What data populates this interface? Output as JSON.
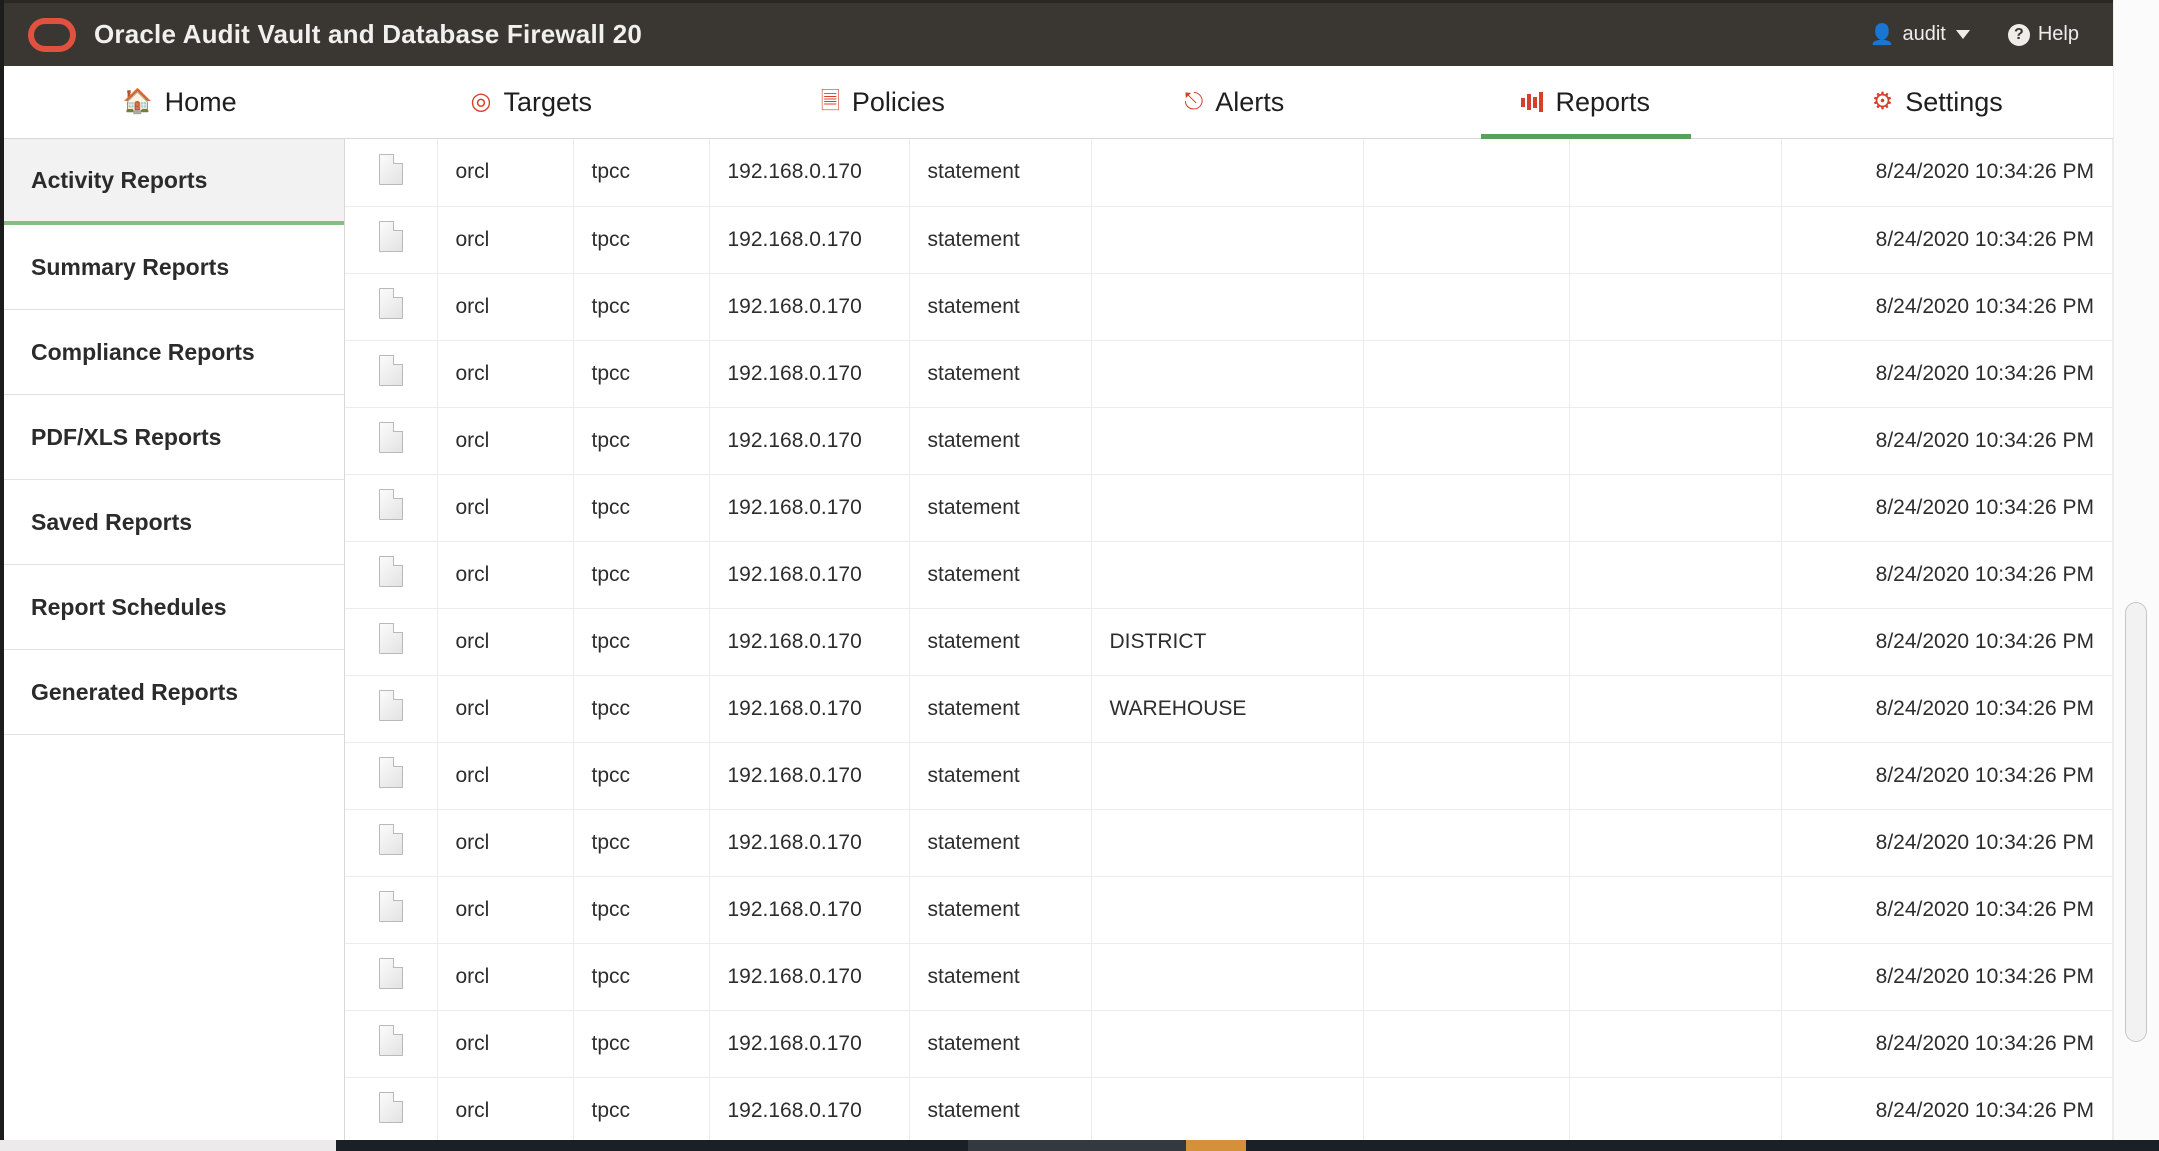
{
  "brand": {
    "title": "Oracle Audit Vault and Database Firewall 20",
    "logo_icon": "oracle-logo-icon",
    "accent_color": "#e0523f",
    "bar_color": "#3a3733"
  },
  "account": {
    "user_icon": "user-icon",
    "username": "audit",
    "caret_icon": "chevron-down-icon",
    "help_icon": "help-circle-icon",
    "help_label": "Help"
  },
  "tabs": [
    {
      "label": "Home",
      "icon": "home-icon",
      "active": false
    },
    {
      "label": "Targets",
      "icon": "target-icon",
      "active": false
    },
    {
      "label": "Policies",
      "icon": "policy-icon",
      "active": false
    },
    {
      "label": "Alerts",
      "icon": "bell-icon",
      "active": false
    },
    {
      "label": "Reports",
      "icon": "bar-chart-icon",
      "active": true
    },
    {
      "label": "Settings",
      "icon": "gear-icon",
      "active": false
    }
  ],
  "active_tab_indicator_color": "#5aa05c",
  "sidebar": {
    "items": [
      {
        "label": "Activity Reports",
        "active": true
      },
      {
        "label": "Summary Reports",
        "active": false
      },
      {
        "label": "Compliance Reports",
        "active": false
      },
      {
        "label": "PDF/XLS Reports",
        "active": false
      },
      {
        "label": "Saved Reports",
        "active": false
      },
      {
        "label": "Report Schedules",
        "active": false
      },
      {
        "label": "Generated Reports",
        "active": false
      }
    ]
  },
  "table": {
    "row_icon": "document-icon",
    "rows": [
      {
        "target": "orcl",
        "user": "tpcc",
        "ip": "192.168.0.170",
        "event": "statement",
        "object": "",
        "objtype": "",
        "extra": "",
        "time": "8/24/2020 10:34:26 PM"
      },
      {
        "target": "orcl",
        "user": "tpcc",
        "ip": "192.168.0.170",
        "event": "statement",
        "object": "",
        "objtype": "",
        "extra": "",
        "time": "8/24/2020 10:34:26 PM"
      },
      {
        "target": "orcl",
        "user": "tpcc",
        "ip": "192.168.0.170",
        "event": "statement",
        "object": "",
        "objtype": "",
        "extra": "",
        "time": "8/24/2020 10:34:26 PM"
      },
      {
        "target": "orcl",
        "user": "tpcc",
        "ip": "192.168.0.170",
        "event": "statement",
        "object": "",
        "objtype": "",
        "extra": "",
        "time": "8/24/2020 10:34:26 PM"
      },
      {
        "target": "orcl",
        "user": "tpcc",
        "ip": "192.168.0.170",
        "event": "statement",
        "object": "",
        "objtype": "",
        "extra": "",
        "time": "8/24/2020 10:34:26 PM"
      },
      {
        "target": "orcl",
        "user": "tpcc",
        "ip": "192.168.0.170",
        "event": "statement",
        "object": "",
        "objtype": "",
        "extra": "",
        "time": "8/24/2020 10:34:26 PM"
      },
      {
        "target": "orcl",
        "user": "tpcc",
        "ip": "192.168.0.170",
        "event": "statement",
        "object": "",
        "objtype": "",
        "extra": "",
        "time": "8/24/2020 10:34:26 PM"
      },
      {
        "target": "orcl",
        "user": "tpcc",
        "ip": "192.168.0.170",
        "event": "statement",
        "object": "DISTRICT",
        "objtype": "",
        "extra": "",
        "time": "8/24/2020 10:34:26 PM"
      },
      {
        "target": "orcl",
        "user": "tpcc",
        "ip": "192.168.0.170",
        "event": "statement",
        "object": "WAREHOUSE",
        "objtype": "",
        "extra": "",
        "time": "8/24/2020 10:34:26 PM"
      },
      {
        "target": "orcl",
        "user": "tpcc",
        "ip": "192.168.0.170",
        "event": "statement",
        "object": "",
        "objtype": "",
        "extra": "",
        "time": "8/24/2020 10:34:26 PM"
      },
      {
        "target": "orcl",
        "user": "tpcc",
        "ip": "192.168.0.170",
        "event": "statement",
        "object": "",
        "objtype": "",
        "extra": "",
        "time": "8/24/2020 10:34:26 PM"
      },
      {
        "target": "orcl",
        "user": "tpcc",
        "ip": "192.168.0.170",
        "event": "statement",
        "object": "",
        "objtype": "",
        "extra": "",
        "time": "8/24/2020 10:34:26 PM"
      },
      {
        "target": "orcl",
        "user": "tpcc",
        "ip": "192.168.0.170",
        "event": "statement",
        "object": "",
        "objtype": "",
        "extra": "",
        "time": "8/24/2020 10:34:26 PM"
      },
      {
        "target": "orcl",
        "user": "tpcc",
        "ip": "192.168.0.170",
        "event": "statement",
        "object": "",
        "objtype": "",
        "extra": "",
        "time": "8/24/2020 10:34:26 PM"
      },
      {
        "target": "orcl",
        "user": "tpcc",
        "ip": "192.168.0.170",
        "event": "statement",
        "object": "",
        "objtype": "",
        "extra": "",
        "time": "8/24/2020 10:34:26 PM"
      }
    ]
  },
  "scrollbars": {
    "vertical_thumb_present": true,
    "horizontal_present": true
  }
}
